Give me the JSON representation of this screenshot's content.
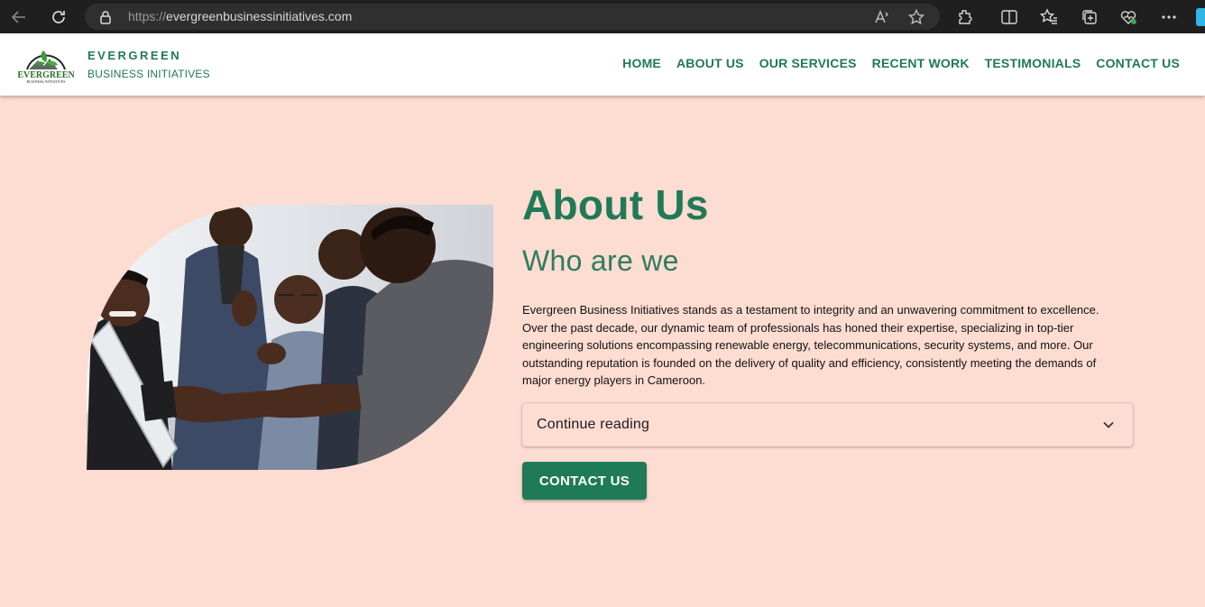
{
  "browser": {
    "url_scheme": "https://",
    "url_host": "evergreenbusinessinitiatives.com",
    "icons": [
      "back-arrow-icon",
      "refresh-icon",
      "lock-icon",
      "read-aloud-icon",
      "favorite-star-icon",
      "extensions-icon",
      "split-screen-icon",
      "favorites-icon",
      "collections-icon",
      "browser-essentials-icon",
      "more-icon"
    ]
  },
  "header": {
    "brand_name": "EVERGREEN",
    "brand_sub": "BUSINESS INITIATIVES",
    "logo_text": "EVERGREEN",
    "logo_subtext": "BUSINESS INITIATIVES",
    "nav": [
      "HOME",
      "ABOUT US",
      "OUR SERVICES",
      "RECENT WORK",
      "TESTIMONIALS",
      "CONTACT US"
    ]
  },
  "about": {
    "title": "About Us",
    "subtitle": "Who are we",
    "body": "Evergreen Business Initiatives stands as a testament to integrity and an unwavering commitment to excellence. Over the past decade, our dynamic team of professionals has honed their expertise, specializing in top-tier engineering solutions encompassing renewable energy, telecommunications, security systems, and more. Our outstanding reputation is founded on the delivery of quality and efficiency, consistently meeting the demands of major energy players in Cameroon.",
    "accordion_label": "Continue reading",
    "cta_label": "CONTACT US"
  },
  "colors": {
    "brand_green": "#1f7a58",
    "page_background": "#fddcd2",
    "header_background": "#ffffff",
    "chrome_background": "#1f1f1f"
  }
}
